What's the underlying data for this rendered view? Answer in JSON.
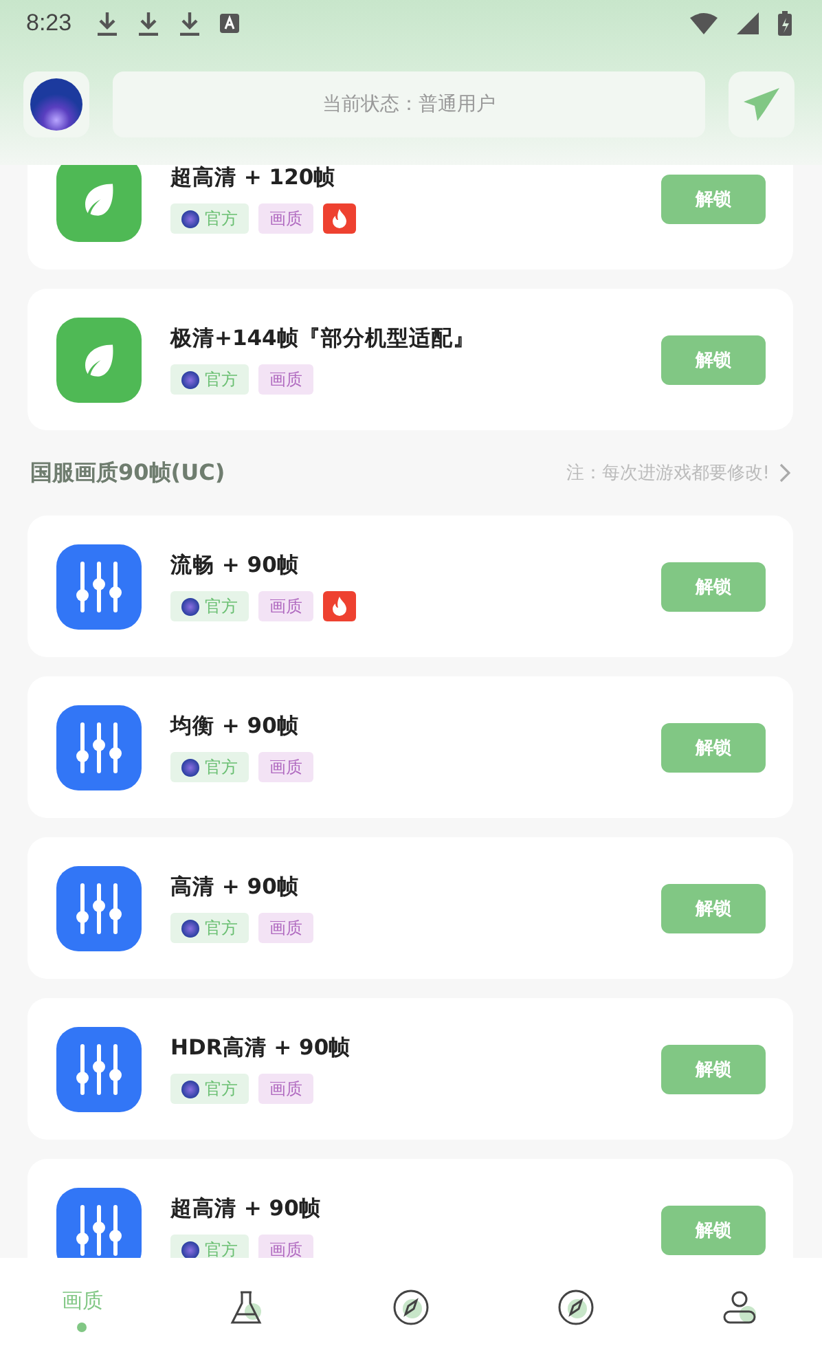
{
  "status_bar": {
    "time": "8:23"
  },
  "header": {
    "status_text": "当前状态：普通用户"
  },
  "sections": [
    {
      "items": [
        {
          "kind": "leaf",
          "title": "超高清 + 120帧",
          "tags": [
            "官方",
            "画质"
          ],
          "hot": true,
          "button": "解锁"
        },
        {
          "kind": "leaf",
          "title": "极清+144帧『部分机型适配』",
          "tags": [
            "官方",
            "画质"
          ],
          "hot": false,
          "button": "解锁"
        }
      ]
    },
    {
      "title": "国服画质90帧(UC)",
      "note": "注：每次进游戏都要修改!",
      "items": [
        {
          "kind": "sliders",
          "title": "流畅 + 90帧",
          "tags": [
            "官方",
            "画质"
          ],
          "hot": true,
          "button": "解锁"
        },
        {
          "kind": "sliders",
          "title": "均衡 + 90帧",
          "tags": [
            "官方",
            "画质"
          ],
          "hot": false,
          "button": "解锁"
        },
        {
          "kind": "sliders",
          "title": "高清 + 90帧",
          "tags": [
            "官方",
            "画质"
          ],
          "hot": false,
          "button": "解锁"
        },
        {
          "kind": "sliders",
          "title": "HDR高清 + 90帧",
          "tags": [
            "官方",
            "画质"
          ],
          "hot": false,
          "button": "解锁"
        },
        {
          "kind": "sliders",
          "title": "超高清 + 90帧",
          "tags": [
            "官方",
            "画质"
          ],
          "hot": false,
          "button": "解锁"
        }
      ]
    }
  ],
  "bottom_nav": [
    {
      "kind": "quality",
      "label": "画质",
      "selected": true
    },
    {
      "kind": "flask",
      "selected": false
    },
    {
      "kind": "compass",
      "selected": false
    },
    {
      "kind": "compass",
      "selected": false
    },
    {
      "kind": "user",
      "selected": false
    }
  ]
}
